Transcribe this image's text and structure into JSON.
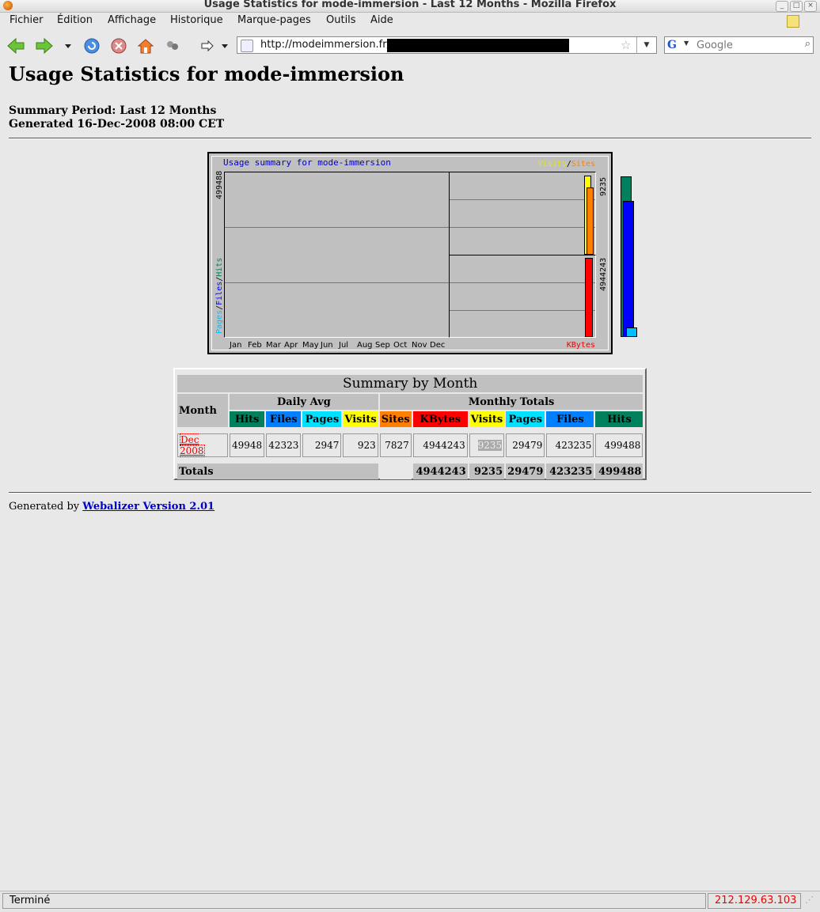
{
  "window": {
    "title": "Usage Statistics for mode-immersion - Last 12 Months - Mozilla Firefox"
  },
  "menu": [
    "Fichier",
    "Édition",
    "Affichage",
    "Historique",
    "Marque-pages",
    "Outils",
    "Aide"
  ],
  "nav": {
    "url": "http://modeimmersion.fr/",
    "search_placeholder": "Google"
  },
  "page": {
    "heading": "Usage Statistics for mode-immersion",
    "period": "Summary Period: Last 12 Months",
    "generated": "Generated 16-Dec-2008 08:00 CET"
  },
  "graph": {
    "title": "Usage summary for mode-immersion",
    "legend_visits": "Visits",
    "legend_sep": "/",
    "legend_sites": "Sites",
    "left_axis": {
      "pages": "Pages",
      "files": "Files",
      "hits": "Hits",
      "sep": "/"
    },
    "left_max": "499488",
    "right_top_max": "9235",
    "right_bottom_max": "4944243",
    "kbytes_label": "KBytes",
    "months": [
      "Jan",
      "Feb",
      "Mar",
      "Apr",
      "May",
      "Jun",
      "Jul",
      "Aug",
      "Sep",
      "Oct",
      "Nov",
      "Dec"
    ],
    "colors": {
      "hits": "#00805c",
      "files": "#0000ff",
      "pages": "#00c0ff",
      "visits": "#ffff00",
      "sites": "#ff8000",
      "kbytes": "#ff0000"
    }
  },
  "chart_data": {
    "type": "bar",
    "title": "Usage summary for mode-immersion",
    "categories": [
      "Jan",
      "Feb",
      "Mar",
      "Apr",
      "May",
      "Jun",
      "Jul",
      "Aug",
      "Sep",
      "Oct",
      "Nov",
      "Dec"
    ],
    "series": [
      {
        "name": "Hits",
        "values": [
          0,
          0,
          0,
          0,
          0,
          0,
          0,
          0,
          0,
          0,
          0,
          499488
        ]
      },
      {
        "name": "Files",
        "values": [
          0,
          0,
          0,
          0,
          0,
          0,
          0,
          0,
          0,
          0,
          0,
          423235
        ]
      },
      {
        "name": "Pages",
        "values": [
          0,
          0,
          0,
          0,
          0,
          0,
          0,
          0,
          0,
          0,
          0,
          29479
        ]
      },
      {
        "name": "Visits",
        "values": [
          0,
          0,
          0,
          0,
          0,
          0,
          0,
          0,
          0,
          0,
          0,
          9235
        ]
      },
      {
        "name": "Sites",
        "values": [
          0,
          0,
          0,
          0,
          0,
          0,
          0,
          0,
          0,
          0,
          0,
          7827
        ]
      },
      {
        "name": "KBytes",
        "values": [
          0,
          0,
          0,
          0,
          0,
          0,
          0,
          0,
          0,
          0,
          0,
          4944243
        ]
      }
    ]
  },
  "summary": {
    "caption": "Summary by Month",
    "month_header": "Month",
    "daily_avg_header": "Daily Avg",
    "monthly_totals_header": "Monthly Totals",
    "daily_cols": [
      "Hits",
      "Files",
      "Pages",
      "Visits"
    ],
    "monthly_cols": [
      "Sites",
      "KBytes",
      "Visits",
      "Pages",
      "Files",
      "Hits"
    ],
    "row": {
      "month": "Dec 2008",
      "daily": [
        "49948",
        "42323",
        "2947",
        "923"
      ],
      "monthly": [
        "7827",
        "4944243",
        "9235",
        "29479",
        "423235",
        "499488"
      ]
    },
    "totals_label": "Totals",
    "totals": [
      "4944243",
      "9235",
      "29479",
      "423235",
      "499488"
    ]
  },
  "footer": {
    "prefix": "Generated by ",
    "link": "Webalizer Version 2.01"
  },
  "status": {
    "text": "Terminé",
    "ip": "212.129.63.103"
  }
}
